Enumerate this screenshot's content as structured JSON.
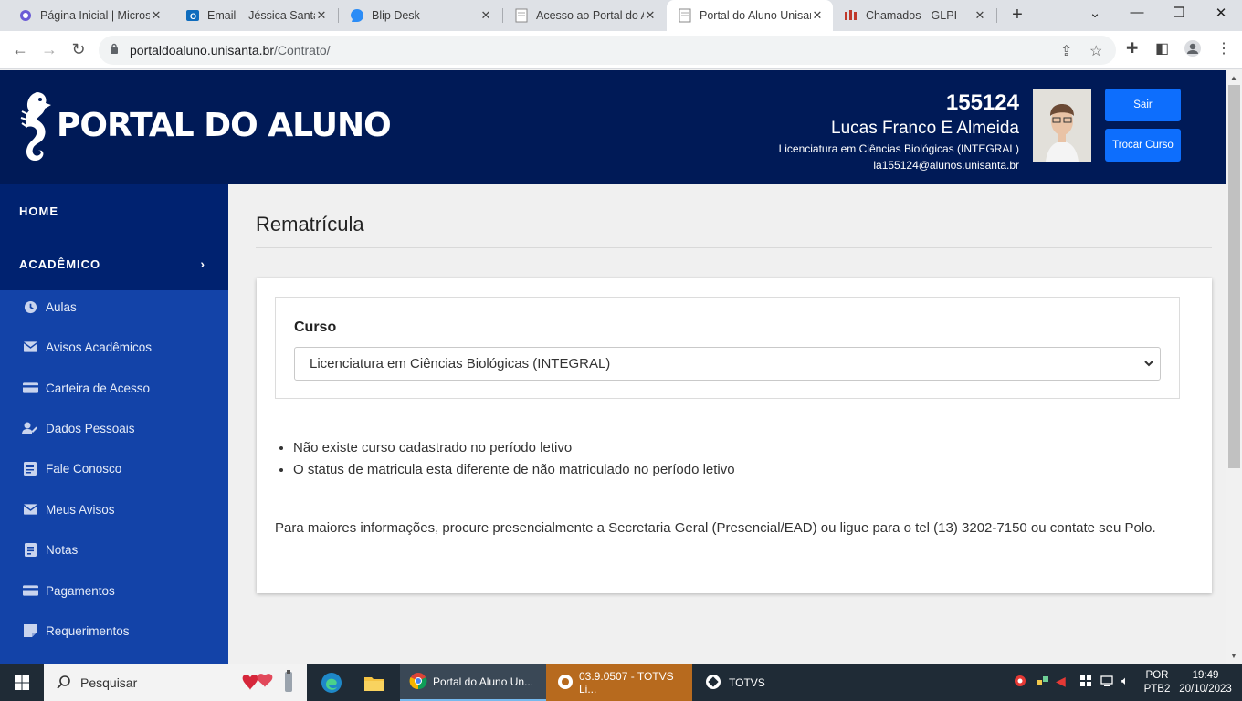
{
  "browser": {
    "tabs": [
      {
        "label": "Página Inicial | Micros",
        "icon": "copilot-icon"
      },
      {
        "label": "Email – Jéssica Santan",
        "icon": "outlook-icon"
      },
      {
        "label": "Blip Desk",
        "icon": "blip-icon"
      },
      {
        "label": "Acesso ao Portal do Al",
        "icon": "document-icon"
      },
      {
        "label": "Portal do Aluno Unisan",
        "icon": "document-icon"
      },
      {
        "label": "Chamados - GLPI",
        "icon": "glpi-icon"
      }
    ],
    "url_host": "portaldoaluno.unisanta.br",
    "url_path": "/Contrato/"
  },
  "header": {
    "logo_text": "PORTAL DO ALUNO",
    "student_id": "155124",
    "student_name": "Lucas Franco E Almeida",
    "course": "Licenciatura em Ciências Biológicas (INTEGRAL)",
    "email": "la155124@alunos.unisanta.br",
    "logout_label": "Sair",
    "change_course_label": "Trocar Curso"
  },
  "sidebar": {
    "home": "HOME",
    "academic": "ACADÊMICO",
    "items": [
      {
        "label": "Aulas",
        "icon": "clock-icon"
      },
      {
        "label": "Avisos Acadêmicos",
        "icon": "envelope-icon"
      },
      {
        "label": "Carteira de Acesso",
        "icon": "credit-card-icon"
      },
      {
        "label": "Dados Pessoais",
        "icon": "user-edit-icon"
      },
      {
        "label": "Fale Conosco",
        "icon": "contact-icon"
      },
      {
        "label": "Meus Avisos",
        "icon": "envelope-icon"
      },
      {
        "label": "Notas",
        "icon": "notes-icon"
      },
      {
        "label": "Pagamentos",
        "icon": "credit-card-icon"
      },
      {
        "label": "Requerimentos",
        "icon": "sticky-note-icon"
      }
    ]
  },
  "main": {
    "title": "Rematrícula",
    "curso_label": "Curso",
    "curso_selected": "Licenciatura em Ciências Biológicas (INTEGRAL)",
    "messages": [
      "Não existe curso cadastrado no período letivo",
      "O status de matricula esta diferente de não matriculado no período letivo"
    ],
    "info": "Para maiores informações, procure presencialmente a Secretaria Geral (Presencial/EAD) ou ligue para o tel (13) 3202-7150 ou contate seu Polo."
  },
  "taskbar": {
    "search_placeholder": "Pesquisar",
    "apps": [
      {
        "label": "Portal do Aluno Un...",
        "icon": "chrome-icon"
      },
      {
        "label": "03.9.0507 - TOTVS Li...",
        "icon": "totvs-icon"
      },
      {
        "label": "TOTVS",
        "icon": "totvs-icon"
      }
    ],
    "lang_top": "POR",
    "lang_bottom": "PTB2",
    "time": "19:49",
    "date": "20/10/2023"
  },
  "colors": {
    "header_bg": "#001a57",
    "sidebar_bg": "#1343a8",
    "sidebar_dark": "#002270",
    "button_blue": "#0d6efd"
  }
}
